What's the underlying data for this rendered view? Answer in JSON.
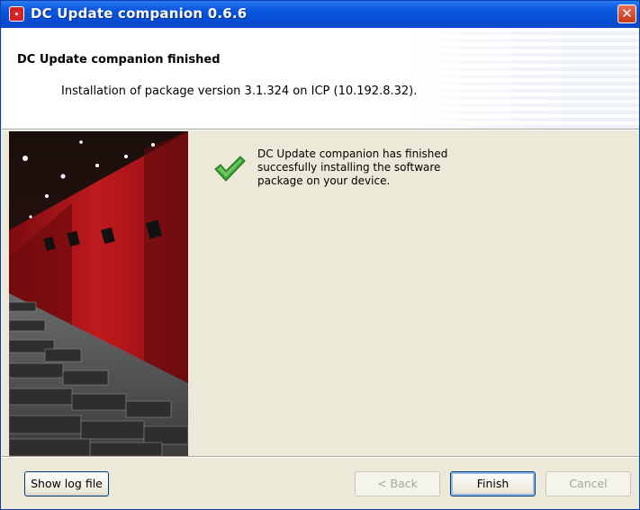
{
  "window": {
    "title": "DC Update companion 0.6.6",
    "close_glyph": "✕",
    "app_icon": "red-target-app-icon"
  },
  "header": {
    "title": "DC Update companion finished",
    "subtitle": "Installation of package version 3.1.324 on ICP (10.192.8.32)."
  },
  "content": {
    "message_lines": [
      "DC Update companion has finished",
      "succesfully installing the software",
      "package on your device."
    ],
    "status_icon": "green-checkmark-icon",
    "side_image": "cinema-auditorium-photo"
  },
  "buttons": {
    "show_log": "Show log file",
    "back": "< Back",
    "finish": "Finish",
    "cancel": "Cancel"
  },
  "colors": {
    "titlebar": "#0450d8",
    "close_button": "#d8502c",
    "check": "#3aa335",
    "wall_red": "#b8161a"
  }
}
